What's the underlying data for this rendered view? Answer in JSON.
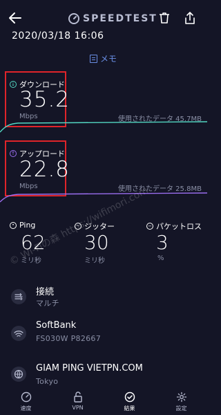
{
  "header": {
    "brand": "SPEEDTEST",
    "datetime": "2020/03/18 16:06",
    "memo_label": "メモ",
    "icons": [
      "back-arrow-icon",
      "speedometer-icon",
      "trash-icon",
      "share-icon"
    ]
  },
  "download": {
    "label": "ダウンロード",
    "value": "35.2",
    "unit": "Mbps",
    "data_used": "使用されたデータ 45.7MB",
    "color": "#53d8c3"
  },
  "upload": {
    "label": "アップロード",
    "value": "22.8",
    "unit": "Mbps",
    "data_used": "使用されたデータ 25.8MB",
    "color": "#9b6ef0"
  },
  "ping": {
    "label": "Ping",
    "value": "62",
    "unit": "ミリ秒"
  },
  "jitter": {
    "label": "ジッター",
    "value": "30",
    "unit": "ミリ秒"
  },
  "packet_loss": {
    "label": "パケットロス",
    "value": "3",
    "unit": "%"
  },
  "connection": {
    "title": "接続",
    "subtitle": "マルチ"
  },
  "provider": {
    "title": "SoftBank",
    "subtitle": "FS030W  P82667"
  },
  "server": {
    "title": "GIAM PING VIETPN.COM",
    "subtitle": "Tokyo"
  },
  "tabs": [
    {
      "label": "速度",
      "icon": "speedometer-icon"
    },
    {
      "label": "VPN",
      "icon": "lock-icon"
    },
    {
      "label": "結果",
      "icon": "check-circle-icon"
    },
    {
      "label": "設定",
      "icon": "gear-icon"
    }
  ],
  "watermark": "© Wi-Fiの森 https://wifimori.com"
}
